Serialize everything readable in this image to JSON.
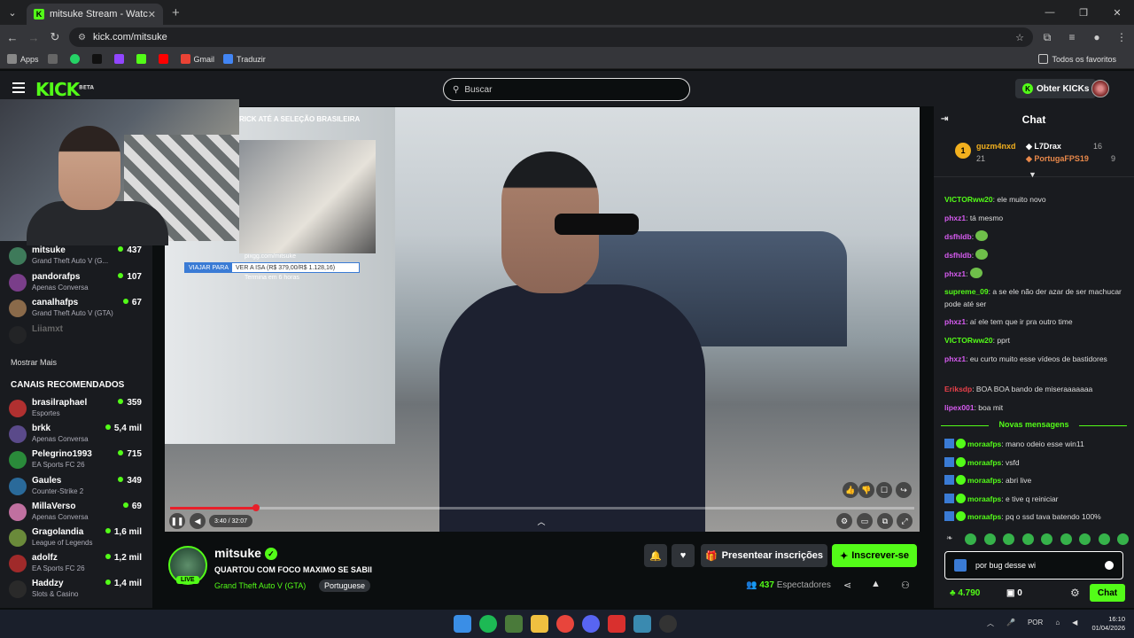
{
  "browser": {
    "tab_title": "mitsuke Stream - Watch Li...",
    "url": "kick.com/mitsuke",
    "bookmarks": [
      "Apps",
      "Gmail",
      "Traduzir"
    ],
    "all_favorites": "Todos os favoritos"
  },
  "header": {
    "logo": "KICK",
    "logo_badge": "BETA",
    "search_placeholder": "Buscar",
    "get_kicks": "Obter KICKs"
  },
  "stream_overlay": {
    "title": "RICK ATÉ A SELEÇÃO BRASILEIRA",
    "url": "pixgg.com/mitsuke",
    "bar_label": "VIAJAR PARA",
    "bar_text": "VER A ISA (R$ 379,00/R$ 1.128,16)",
    "ends": "Termina em 6 horas"
  },
  "sidebar": {
    "following": [
      {
        "name": "mitsuke",
        "category": "Grand Theft Auto V (G...",
        "viewers": "437",
        "color": "#3e7a5a"
      },
      {
        "name": "pandorafps",
        "category": "Apenas Conversa",
        "viewers": "107",
        "color": "#7a3e8a"
      },
      {
        "name": "canalhafps",
        "category": "Grand Theft Auto V (GTA)",
        "viewers": "67",
        "color": "#8a6a4a"
      },
      {
        "name": "Liiamxt",
        "category": "",
        "viewers": "",
        "color": "#333333"
      }
    ],
    "show_more": "Mostrar Mais",
    "recommended_title": "CANAIS RECOMENDADOS",
    "recommended": [
      {
        "name": "brasilraphael",
        "category": "Esportes",
        "viewers": "359",
        "color": "#b03030"
      },
      {
        "name": "brkk",
        "category": "Apenas Conversa",
        "viewers": "5,4 mil",
        "color": "#5a4a8a"
      },
      {
        "name": "Pelegrino1993",
        "category": "EA Sports FC 26",
        "viewers": "715",
        "color": "#2a8a3a"
      },
      {
        "name": "Gaules",
        "category": "Counter-Strike 2",
        "viewers": "349",
        "color": "#2a6a9a"
      },
      {
        "name": "MillaVerso",
        "category": "Apenas Conversa",
        "viewers": "69",
        "color": "#c070a0"
      },
      {
        "name": "Gragolandia",
        "category": "League of Legends",
        "viewers": "1,6 mil",
        "color": "#6a8a3a"
      },
      {
        "name": "adolfz",
        "category": "EA Sports FC 26",
        "viewers": "1,2 mil",
        "color": "#a02a2a"
      },
      {
        "name": "Haddzy",
        "category": "Slots & Casino",
        "viewers": "1,4 mil",
        "color": "#2a2a2a"
      }
    ]
  },
  "player": {
    "time": "3:40 / 32:07",
    "progress": 0.115
  },
  "stream": {
    "channel": "mitsuke",
    "live": "LIVE",
    "title": "QUARTOU COM FOCO MAXIMO SE SABII",
    "category": "Grand Theft Auto V (GTA)",
    "language": "Portuguese",
    "gift_button": "Presentear inscrições",
    "subscribe_button": "Inscrever-se",
    "viewers": "437",
    "viewers_label": "Espectadores"
  },
  "chat": {
    "title": "Chat",
    "leaderboard": [
      {
        "rank": "1",
        "name": "guzm4nxd",
        "count": "21"
      },
      {
        "name": "L7Drax",
        "count": "16"
      },
      {
        "name": "PortugaFPS19",
        "count": "9"
      }
    ],
    "messages": [
      {
        "user": "VICTORww20",
        "color": "#53fc18",
        "text": ": ele muito novo"
      },
      {
        "user": "phxz1",
        "color": "#d65bf0",
        "text": ": tá mesmo"
      },
      {
        "user": "dsfhldb",
        "color": "#d65bf0",
        "text": ":",
        "emote": true
      },
      {
        "user": "dsfhldb",
        "color": "#d65bf0",
        "text": ":",
        "emote": true
      },
      {
        "user": "phxz1",
        "color": "#d65bf0",
        "text": ":",
        "emote": true
      },
      {
        "user": "supreme_09",
        "color": "#53fc18",
        "text": ": a se ele não der azar de ser machucar pode até ser"
      },
      {
        "user": "phxz1",
        "color": "#d65bf0",
        "text": ": aí ele tem que ir pra outro time"
      },
      {
        "user": "VICTORww20",
        "color": "#53fc18",
        "text": ": pprt"
      },
      {
        "user": "phxz1",
        "color": "#d65bf0",
        "text": ": eu curto muito esse vídeos de bastidores"
      },
      {
        "user": "Eriksdp",
        "color": "#e8404a",
        "text": ": BOA BOA bando de miseraaaaaaa"
      },
      {
        "user": "lipex001",
        "color": "#d65bf0",
        "text": ": boa mit"
      }
    ],
    "new_messages": "Novas mensagens",
    "new": [
      {
        "user": "moraafps",
        "text": ": mano odeio esse win11"
      },
      {
        "user": "moraafps",
        "text": ": vsfd"
      },
      {
        "user": "moraafps",
        "text": ": abri live"
      },
      {
        "user": "moraafps",
        "text": ": e tive q reiniciar"
      },
      {
        "user": "moraafps",
        "text": ": pq o ssd tava batendo 100%"
      }
    ],
    "input_value": "por bug desse wi",
    "points": "4.790",
    "zero": "0",
    "send": "Chat"
  },
  "taskbar": {
    "lang": "POR",
    "time": "16:10",
    "date": "01/04/2026"
  }
}
